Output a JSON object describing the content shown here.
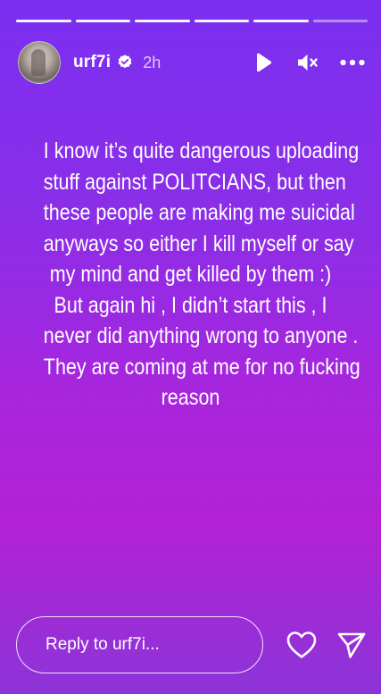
{
  "story": {
    "progress": {
      "total_segments": 6,
      "viewed_segments": 5
    },
    "user": {
      "username": "urf7i",
      "verified": true,
      "time_ago": "2h"
    },
    "controls": {
      "play_icon": "play-icon",
      "mute_icon": "muted-speaker-icon",
      "more_icon": "more-options-icon"
    },
    "text_lines": [
      "I know it’s quite dangerous uploading",
      "stuff against POLITCIANS, but then",
      "these people are making me suicidal",
      "anyways so either I kill myself or say",
      "my mind and get killed by them :)",
      "But again hi , I didn’t start this , I",
      "never did anything wrong to anyone .",
      "They are coming at me for no fucking",
      "reason"
    ],
    "reply": {
      "placeholder": "Reply to urf7i..."
    },
    "colors": {
      "gradient_top": "#7b2ff0",
      "gradient_mid": "#b322d4",
      "gradient_bottom": "#8c34d8",
      "text": "#ffffff"
    }
  }
}
